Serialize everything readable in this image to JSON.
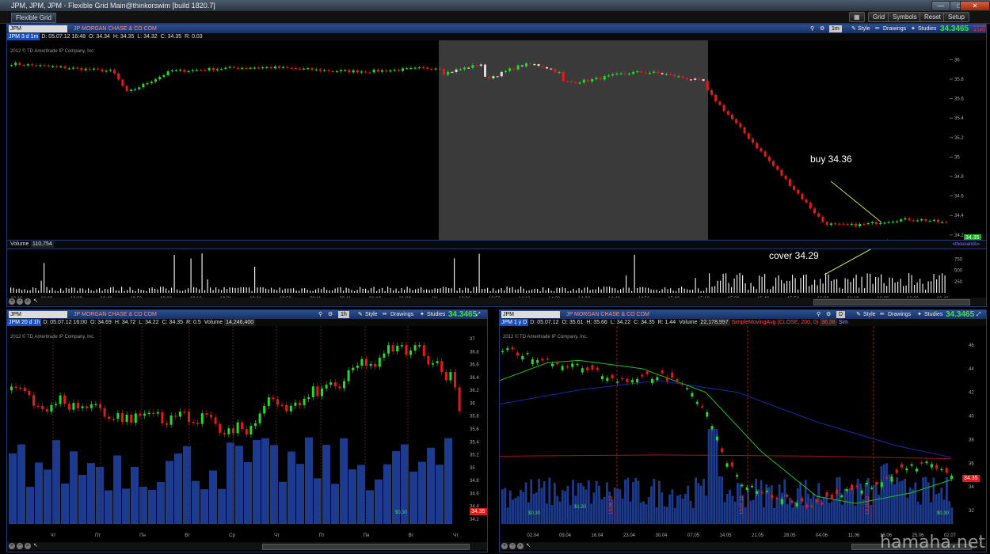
{
  "window": {
    "title": "JPM, JPM, JPM - Flexible Grid Main@thinkorswim [build 1820.7]",
    "grid_tab": "Flexible Grid",
    "menu": [
      "Grid",
      "Symbols",
      "Reset",
      "Setup"
    ]
  },
  "top_chart": {
    "symbol": "JPM",
    "company": "JP MORGAN CHASE & CO COM",
    "aggregation": "1m",
    "toolbar": {
      "style": "Style",
      "drawings": "Drawings",
      "studies": "Studies"
    },
    "last_price": "34.3465",
    "change": [
      "-1.6728",
      "-4.64%"
    ],
    "quote": {
      "period": "JPM 3 d 1m",
      "date": "D: 05.07.12 16:48",
      "open": "O: 34.34",
      "high": "H: 34.35",
      "low": "L: 34.32",
      "close": "C: 34.35",
      "range": "R: 0.03"
    },
    "copyright": "2012 © TD Ameritrade IP Company, Inc.",
    "y_ticks": [
      "36",
      "35.8",
      "35.6",
      "35.4",
      "35.2",
      "35",
      "34.8",
      "34.6",
      "34.4",
      "34.2"
    ],
    "current_price_label": "34.35",
    "volume_label": "Volume",
    "volume_value": "110,754",
    "volume_unit": "«thousands»",
    "volume_ticks": [
      "750",
      "500",
      "250"
    ],
    "x_ticks": [
      "10:10",
      "18:20",
      "18:30",
      "18:40",
      "18:50",
      "19:00",
      "19:10",
      "19:21",
      "19:31",
      "19:50",
      "20:11",
      "20:41",
      "21:10",
      "21:30",
      "Чт",
      "13:32",
      "13:52",
      "14:10",
      "14:20",
      "14:33",
      "14:40",
      "14:50",
      "15:00",
      "15:10",
      "15:30",
      "15:40",
      "15:50",
      "16:00",
      "16:10",
      "16:20",
      "16:30",
      "16:40"
    ],
    "annotations": {
      "buy": "buy 34.36",
      "cover": "cover 34.29"
    },
    "colors": {
      "up": "#22dd22",
      "down": "#e81818",
      "shade": "#3a3a3a",
      "volume": "#e8e8e8"
    }
  },
  "bottom_left_chart": {
    "symbol": "JPM",
    "company": "JP MORGAN CHASE & CO COM",
    "aggregation": "1h",
    "toolbar": {
      "style": "Style",
      "drawings": "Drawings",
      "studies": "Studies"
    },
    "last_price": "34.3465",
    "change": [
      "-1.6728",
      "-4.64%"
    ],
    "quote": {
      "period": "JPM 20 d 1h",
      "date": "D: 05.07.12 16:00",
      "open": "O: 34.69",
      "high": "H: 34.72",
      "low": "L: 34.22",
      "close": "C: 34.35",
      "range": "R: 0.5",
      "volume_label": "Volume",
      "volume_value": "14,246,400"
    },
    "copyright": "2012 © TD Ameritrade IP Company, Inc.",
    "y_ticks": [
      "37",
      "36.8",
      "36.6",
      "36.4",
      "36.2",
      "36",
      "35.8",
      "35.6",
      "35.4",
      "35.2",
      "35",
      "34.8",
      "34.6",
      "34.4",
      "34.2"
    ],
    "current_price_label": "34.35",
    "dividend_label": "$0.30",
    "x_ticks": [
      "Чт",
      "Пт",
      "Пн",
      "Вт",
      "Ср",
      "Чт",
      "Пт",
      "Пн",
      "Вт",
      "Чт"
    ]
  },
  "bottom_right_chart": {
    "symbol": "JPM",
    "company": "JP MORGAN CHASE & CO COM",
    "aggregation": "D",
    "toolbar": {
      "style": "Style",
      "drawings": "Drawings",
      "studies": "Studies"
    },
    "last_price": "34.3465",
    "change": [
      "-1.6728",
      "-4.64%"
    ],
    "quote": {
      "period": "JPM 1 y D",
      "date": "D: 05.07.12",
      "open": "O: 35.61",
      "high": "H: 35.66",
      "low": "L: 34.22",
      "close": "C: 34.35",
      "range": "R: 1.44",
      "volume_label": "Volume",
      "volume_value": "22,178,997",
      "sma_label": "SimpleMovingAvg (CLOSE, 200, 0)",
      "sma_value": "36.38",
      "extra": "Sim"
    },
    "copyright": "2012 © TD Ameritrade IP Company, Inc.",
    "y_ticks": [
      "46",
      "44",
      "42",
      "40",
      "38",
      "36",
      "34",
      "32"
    ],
    "current_price_label": "34.35",
    "dividend_labels": [
      "$0.30",
      "$1.30",
      "$0.30"
    ],
    "earnings_labels": [
      "13.04.12",
      "13.07.12",
      "13.10.12"
    ],
    "x_ticks": [
      "02.04",
      "09.04",
      "16.04",
      "23.04",
      "30.04",
      "07.05",
      "14.05",
      "21.05",
      "28.05",
      "04.06",
      "11.06",
      "18.06",
      "25.06",
      "02.07"
    ],
    "sma_colors": {
      "fast": "#20c020",
      "mid": "#1a28a8",
      "slow": "#a01818"
    }
  },
  "watermark": "hamaha.net"
}
